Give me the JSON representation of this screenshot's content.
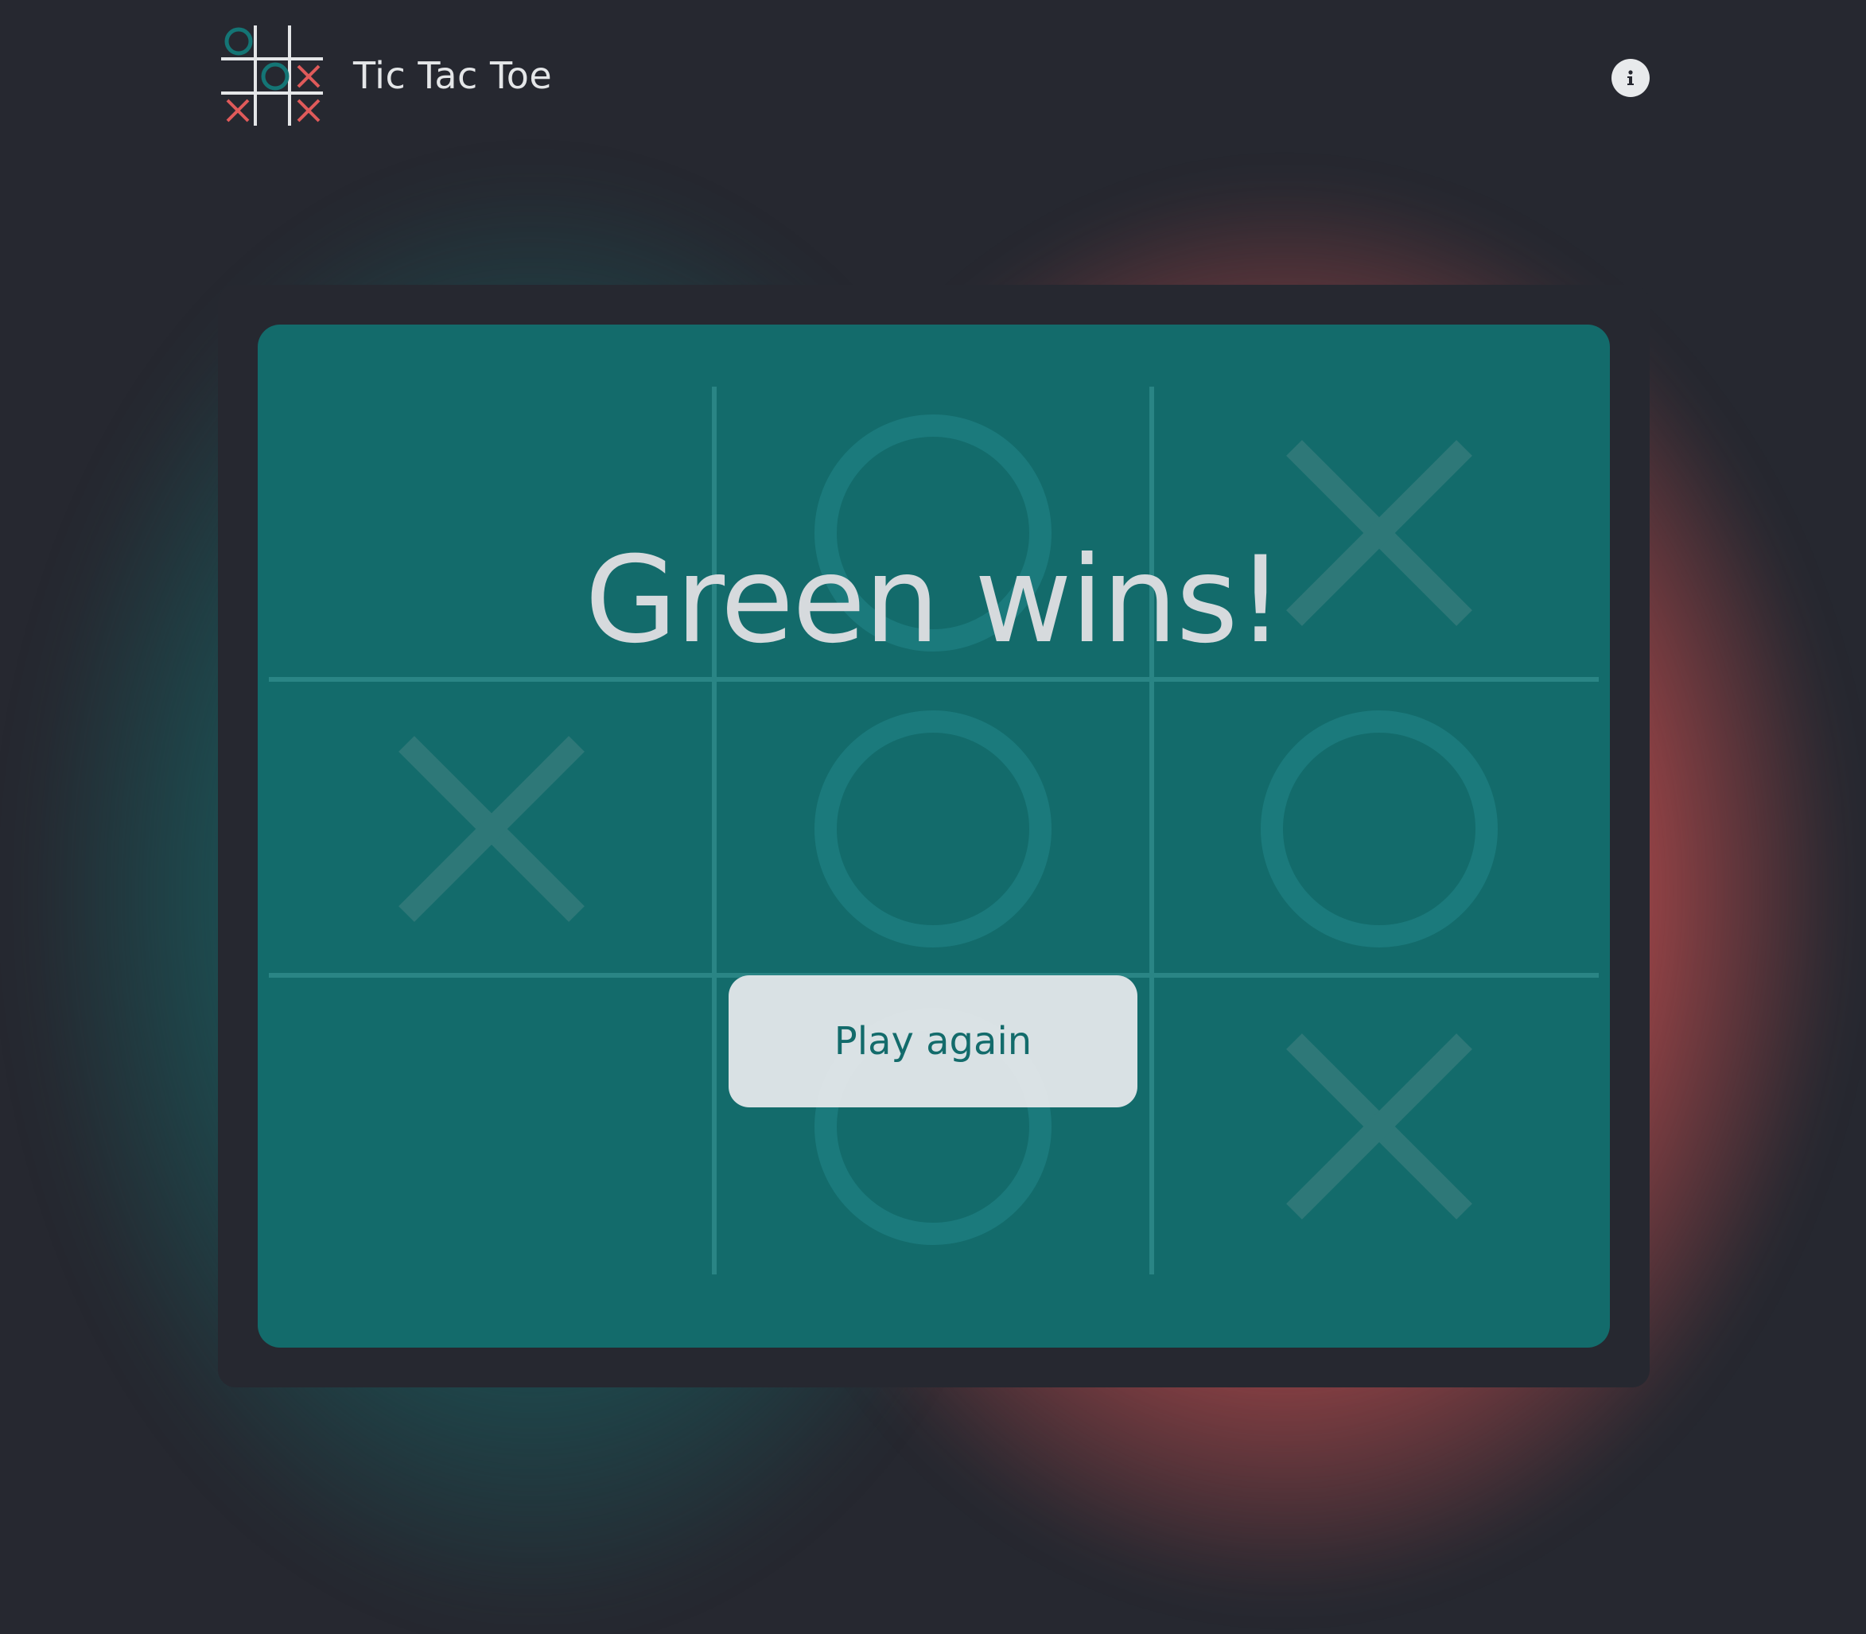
{
  "app": {
    "title": "Tic Tac Toe"
  },
  "header": {
    "info_icon": "info-icon"
  },
  "colors": {
    "background": "#262830",
    "teal": "#136b6b",
    "red": "#e05a5a",
    "light": "#e4e6e8"
  },
  "game": {
    "board": [
      [
        "",
        "O",
        "X"
      ],
      [
        "X",
        "O",
        "O"
      ],
      [
        "",
        "O",
        "X"
      ]
    ],
    "result": "Green wins!",
    "play_again_label": "Play again"
  }
}
